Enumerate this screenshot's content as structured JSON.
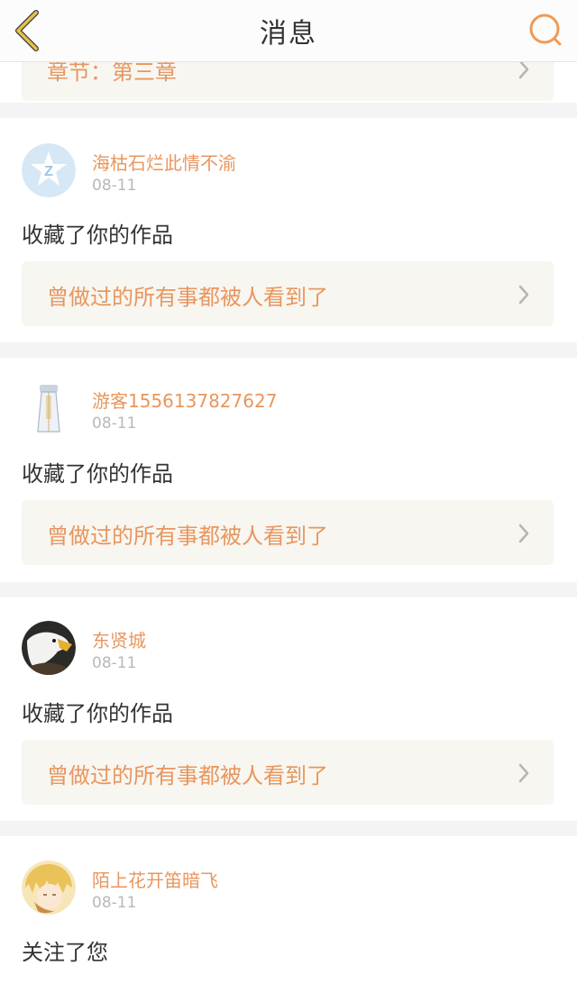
{
  "header": {
    "title": "消息",
    "back_icon": "chevron-left-icon",
    "search_icon": "search-icon"
  },
  "top_partial": {
    "target_label": "章节：第三章"
  },
  "messages": [
    {
      "username": "海枯石烂此情不渝",
      "date": "08-11",
      "action": "收藏了你的作品",
      "target": "曾做过的所有事都被人看到了",
      "avatar": "default-z-avatar"
    },
    {
      "username": "游客1556137827627",
      "date": "08-11",
      "action": "收藏了你的作品",
      "target": "曾做过的所有事都被人看到了",
      "avatar": "figure-avatar"
    },
    {
      "username": "东贤城",
      "date": "08-11",
      "action": "收藏了你的作品",
      "target": "曾做过的所有事都被人看到了",
      "avatar": "eagle-avatar"
    },
    {
      "username": "陌上花开笛暗飞",
      "date": "08-11",
      "action": "关注了您",
      "avatar": "anime-avatar"
    }
  ],
  "colors": {
    "accent": "#e9965d",
    "back_icon": "#e5c04a"
  }
}
